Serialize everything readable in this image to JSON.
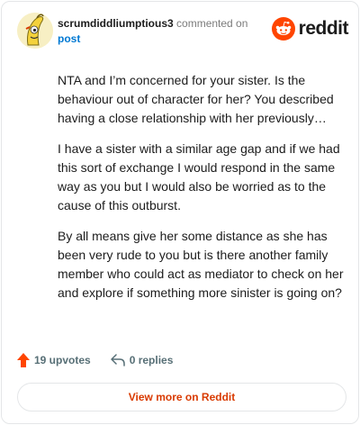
{
  "header": {
    "username": "scrumdiddliumptious3",
    "action_text": "commented on",
    "post_link": "post",
    "brand": "reddit"
  },
  "comment": {
    "paragraphs": [
      "NTA and I’m concerned for your sister. Is the behaviour out of character for her? You described having a close relationship with her previously…",
      "I have a sister with a similar age gap and if we had this sort of exchange I would respond in the same way as you but I would also be worried as to the cause of this outburst.",
      "By all means give her some distance as she has been very rude to you but is there another family member who could act as mediator to check on her and explore if something more sinister is going on?"
    ]
  },
  "footer": {
    "upvotes": "19 upvotes",
    "replies": "0 replies",
    "view_more": "View more on Reddit"
  },
  "colors": {
    "accent": "#ff4500",
    "link": "#0079d3",
    "view_more": "#d93a00"
  },
  "icons": {
    "brand": "reddit-snoo-icon",
    "upvote": "upvote-arrow-icon",
    "reply": "reply-arrow-icon",
    "avatar": "avatar-banana-icon"
  }
}
